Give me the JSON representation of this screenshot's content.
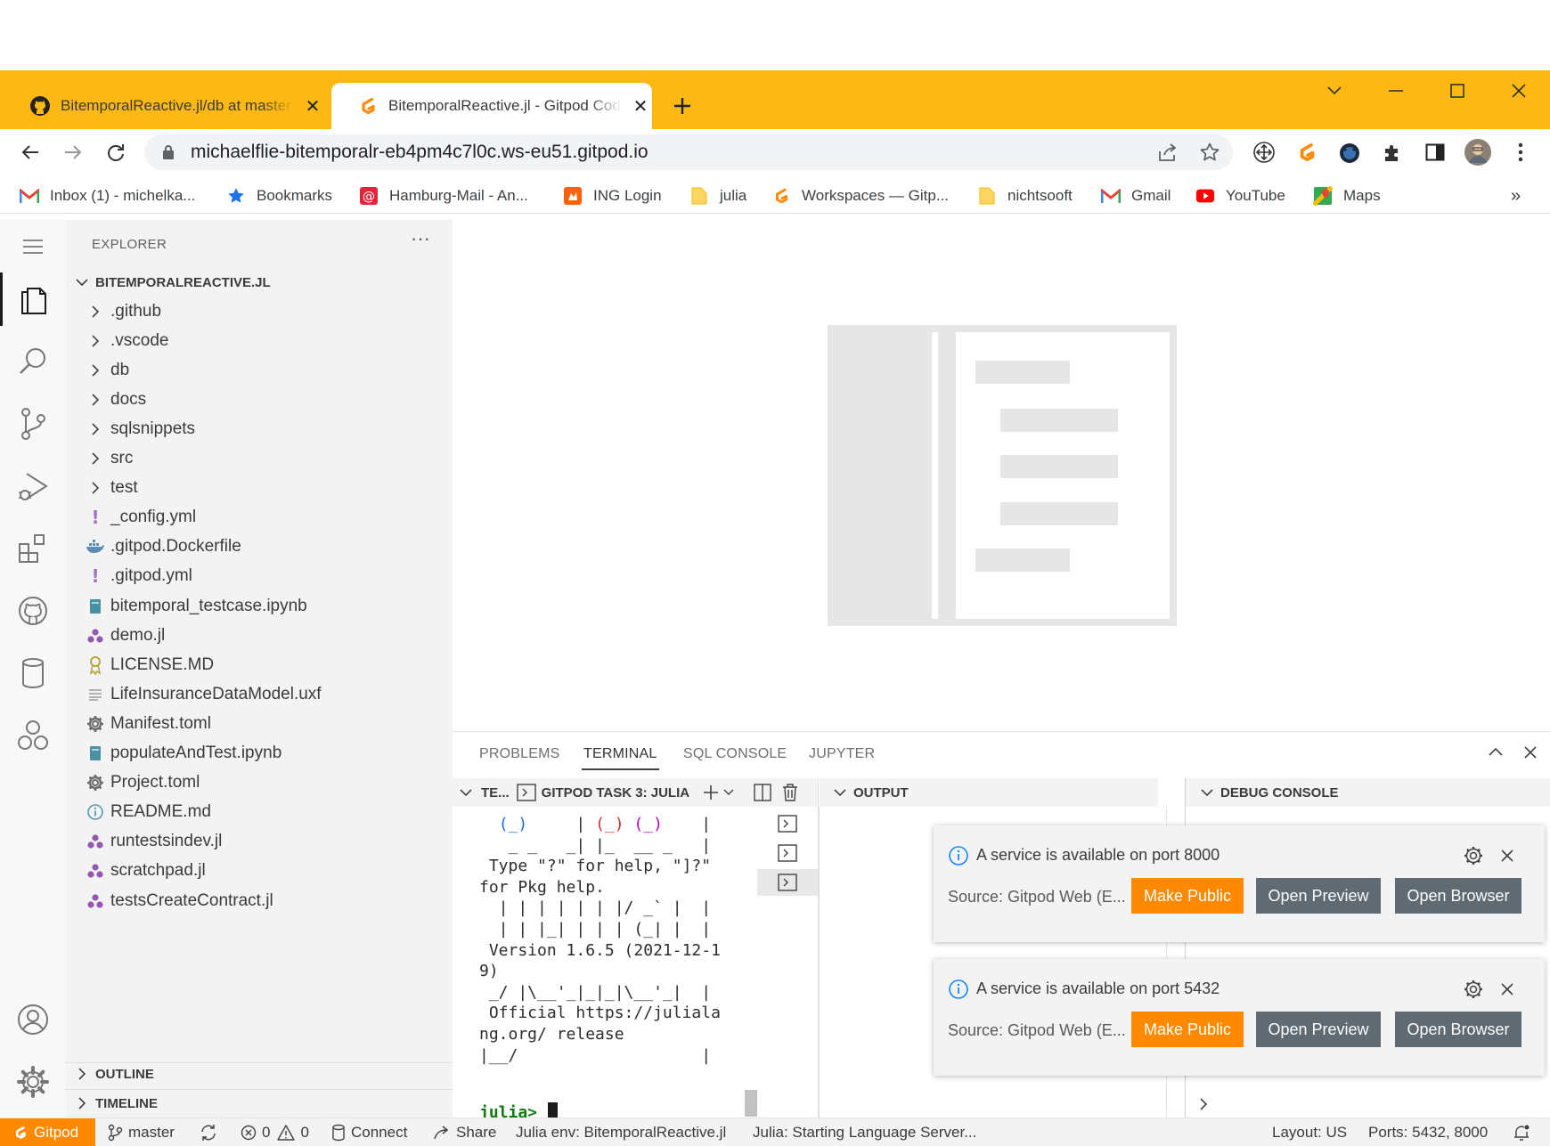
{
  "browser": {
    "tabs": [
      {
        "title": "BitemporalReactive.jl/db at master",
        "favicon": "github-icon",
        "active": false
      },
      {
        "title": "BitemporalReactive.jl - Gitpod Code",
        "favicon": "gitpod-icon",
        "active": true
      }
    ],
    "url": "michaelflie-bitemporalr-eb4pm4c7l0c.ws-eu51.gitpod.io",
    "accent_color": "#FDB813",
    "bookmarks": [
      {
        "label": "Inbox (1) - michelka...",
        "icon": "gmail-icon"
      },
      {
        "label": "Bookmarks",
        "icon": "star-icon"
      },
      {
        "label": "Hamburg-Mail - An...",
        "icon": "mail-at-icon"
      },
      {
        "label": "ING Login",
        "icon": "ing-lion-icon"
      },
      {
        "label": "julia",
        "icon": "folder-icon"
      },
      {
        "label": "Workspaces — Gitp...",
        "icon": "gitpod-icon"
      },
      {
        "label": "nichtsooft",
        "icon": "folder-icon"
      },
      {
        "label": "Gmail",
        "icon": "gmail-icon"
      },
      {
        "label": "YouTube",
        "icon": "youtube-icon"
      },
      {
        "label": "Maps",
        "icon": "maps-icon"
      }
    ],
    "bookmarks_overflow": "»"
  },
  "explorer": {
    "title": "EXPLORER",
    "more": "···",
    "root": "BITEMPORALREACTIVE.JL",
    "items": [
      {
        "label": ".github",
        "type": "folder"
      },
      {
        "label": ".vscode",
        "type": "folder"
      },
      {
        "label": "db",
        "type": "folder"
      },
      {
        "label": "docs",
        "type": "folder"
      },
      {
        "label": "sqlsnippets",
        "type": "folder"
      },
      {
        "label": "src",
        "type": "folder"
      },
      {
        "label": "test",
        "type": "folder"
      },
      {
        "label": "_config.yml",
        "type": "yml"
      },
      {
        "label": ".gitpod.Dockerfile",
        "type": "docker"
      },
      {
        "label": ".gitpod.yml",
        "type": "yml"
      },
      {
        "label": "bitemporal_testcase.ipynb",
        "type": "notebook"
      },
      {
        "label": "demo.jl",
        "type": "julia"
      },
      {
        "label": "LICENSE.MD",
        "type": "license"
      },
      {
        "label": "LifeInsuranceDataModel.uxf",
        "type": "text"
      },
      {
        "label": "Manifest.toml",
        "type": "gear"
      },
      {
        "label": "populateAndTest.ipynb",
        "type": "notebook"
      },
      {
        "label": "Project.toml",
        "type": "gear"
      },
      {
        "label": "README.md",
        "type": "info"
      },
      {
        "label": "runtestsindev.jl",
        "type": "julia"
      },
      {
        "label": "scratchpad.jl",
        "type": "julia"
      },
      {
        "label": "testsCreateContract.jl",
        "type": "julia"
      }
    ],
    "outline": "OUTLINE",
    "timeline": "TIMELINE"
  },
  "panel": {
    "tabs": [
      "PROBLEMS",
      "TERMINAL",
      "SQL CONSOLE",
      "JUPYTER"
    ],
    "active_tab": "TERMINAL",
    "terminal_head": {
      "short": "TE...",
      "task": "GITPOD TASK 3: JULIA"
    },
    "output_head": "OUTPUT",
    "debug_head": "DEBUG CONSOLE",
    "terminal_lines": [
      "  (_)     | (_) (_)    |",
      "   _ _   _| |_  __ _   |",
      " Type \"?\" for help, \"]?\"",
      "for Pkg help.",
      "  | | | | | | |/ _` |  |",
      "  | | |_| | | | (_| |  |",
      " Version 1.6.5 (2021-12-1",
      "9)",
      " _/ |\\__'_|_|_|\\__'_|  |",
      " Official https://juliala",
      "ng.org/ release",
      "|__/                   |"
    ],
    "prompt": "julia>"
  },
  "notifications": [
    {
      "message": "A service is available on port 8000",
      "source": "Source: Gitpod Web (E...",
      "buttons": [
        "Make Public",
        "Open Preview",
        "Open Browser"
      ]
    },
    {
      "message": "A service is available on port 5432",
      "source": "Source: Gitpod Web (E...",
      "buttons": [
        "Make Public",
        "Open Preview",
        "Open Browser"
      ]
    }
  ],
  "statusbar": {
    "gitpod": "Gitpod",
    "branch": "master",
    "errors": "0",
    "warnings": "0",
    "connect": "Connect",
    "share": "Share",
    "julia_env": "Julia env: BitemporalReactive.jl",
    "julia_status": "Julia: Starting Language Server...",
    "layout": "Layout: US",
    "ports": "Ports: 5432, 8000",
    "accent_color": "#FF8A00"
  }
}
